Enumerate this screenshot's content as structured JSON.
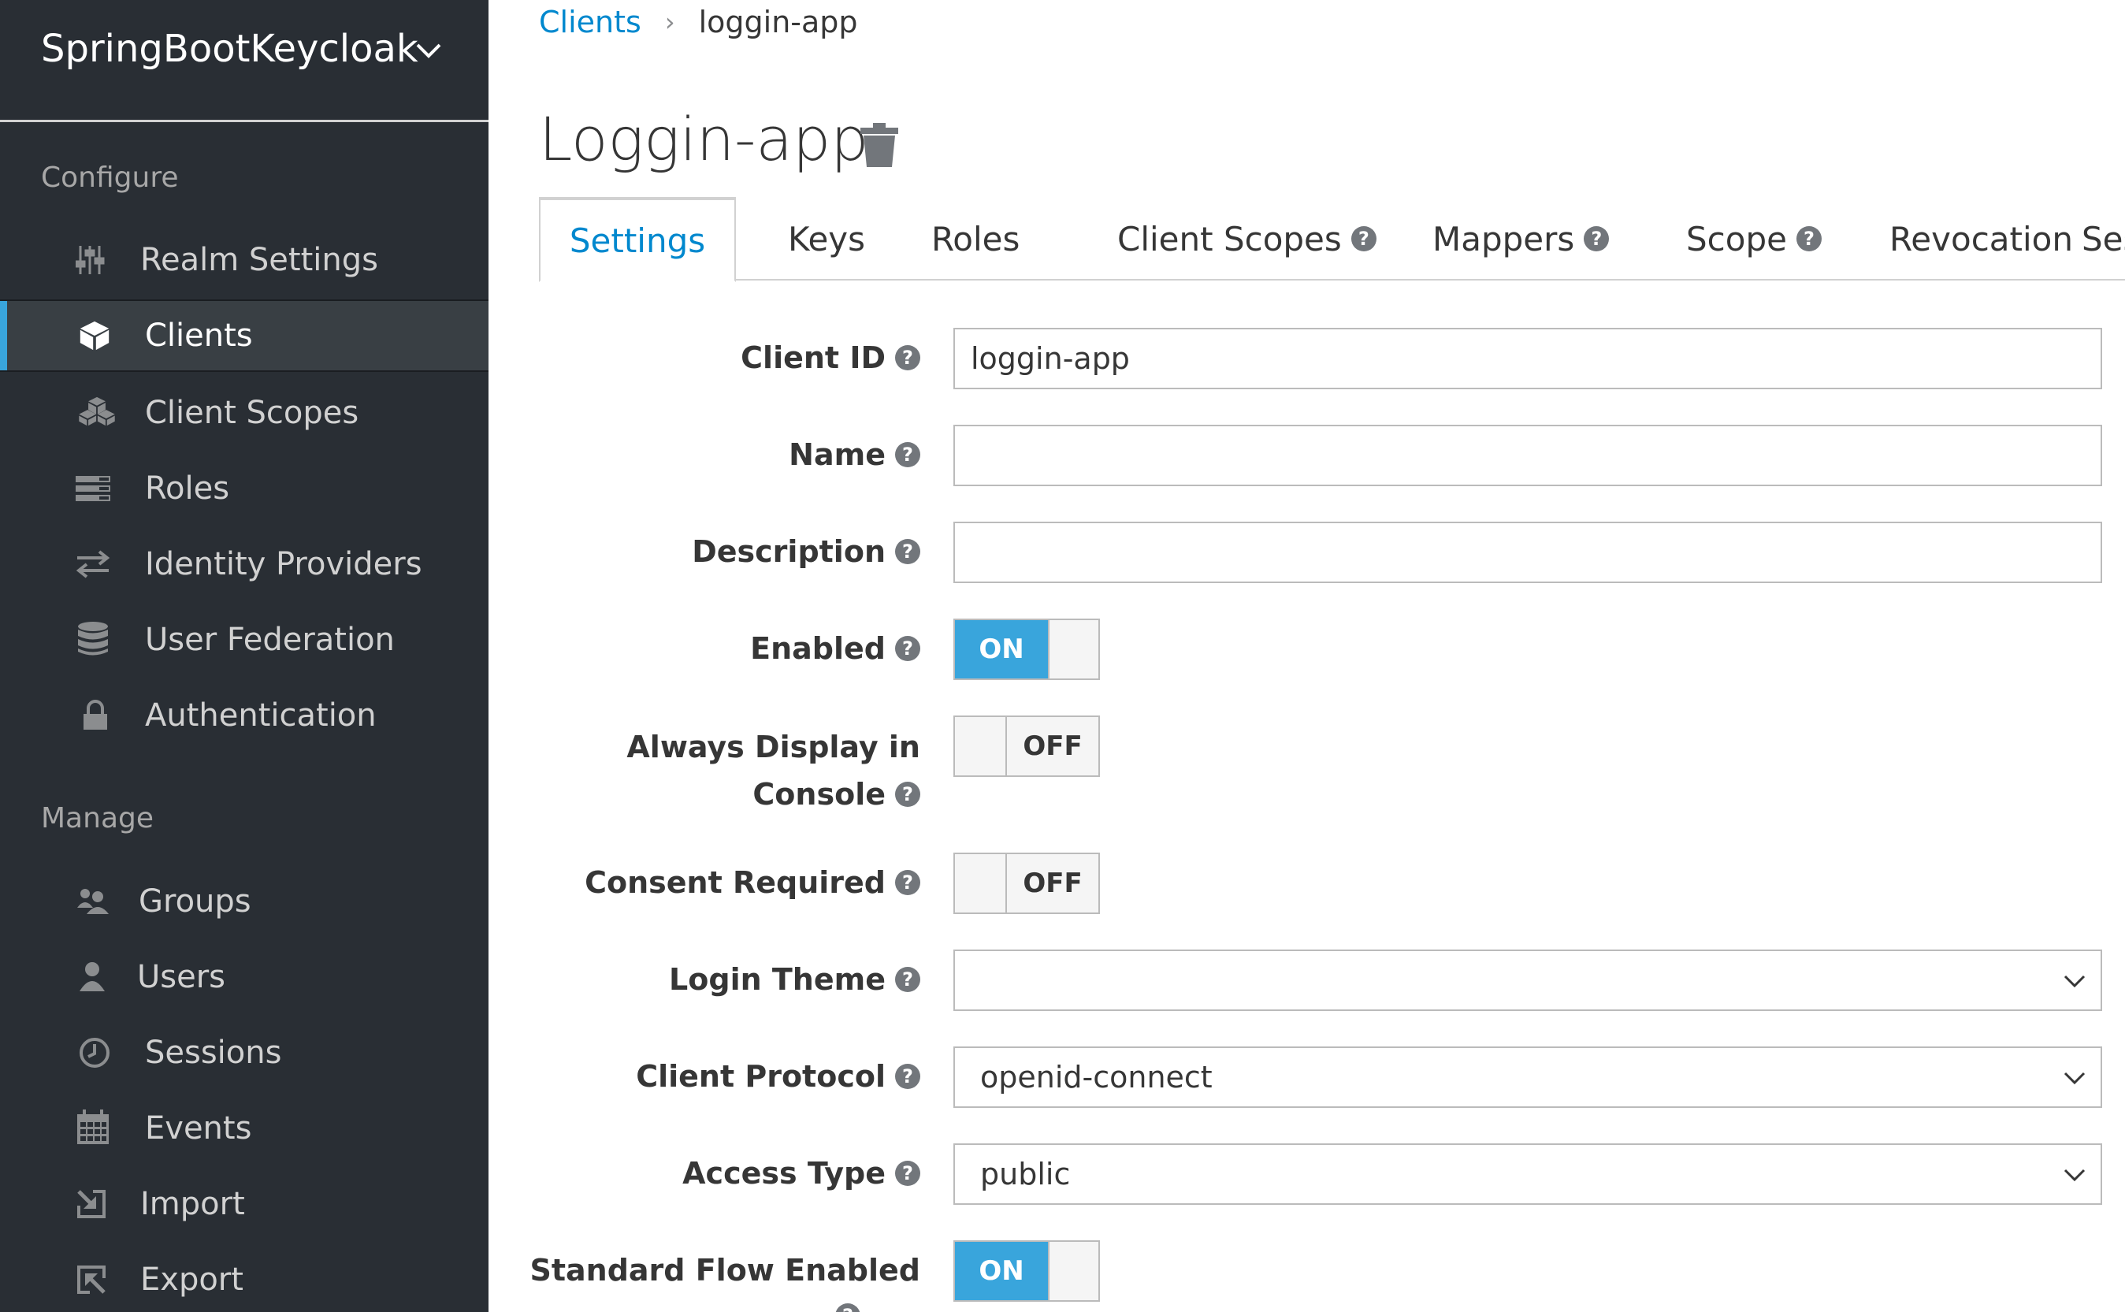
{
  "sidebar": {
    "realm_name": "SpringBootKeycloak",
    "configure_label": "Configure",
    "manage_label": "Manage",
    "configure_items": [
      {
        "label": "Realm Settings",
        "icon": "sliders-icon"
      },
      {
        "label": "Clients",
        "icon": "cube-icon",
        "active": true
      },
      {
        "label": "Client Scopes",
        "icon": "cubes-icon"
      },
      {
        "label": "Roles",
        "icon": "list-icon"
      },
      {
        "label": "Identity Providers",
        "icon": "exchange-icon"
      },
      {
        "label": "User Federation",
        "icon": "database-icon"
      },
      {
        "label": "Authentication",
        "icon": "lock-icon"
      }
    ],
    "manage_items": [
      {
        "label": "Groups",
        "icon": "users-icon"
      },
      {
        "label": "Users",
        "icon": "user-icon"
      },
      {
        "label": "Sessions",
        "icon": "clock-icon"
      },
      {
        "label": "Events",
        "icon": "calendar-icon"
      },
      {
        "label": "Import",
        "icon": "import-icon"
      },
      {
        "label": "Export",
        "icon": "export-icon"
      }
    ]
  },
  "breadcrumb": {
    "parent": "Clients",
    "separator": "›",
    "current": "loggin-app"
  },
  "page": {
    "title": "Loggin-app"
  },
  "tabs": [
    {
      "label": "Settings",
      "active": true,
      "help": false
    },
    {
      "label": "Keys",
      "help": false
    },
    {
      "label": "Roles",
      "help": false
    },
    {
      "label": "Client Scopes",
      "help": true
    },
    {
      "label": "Mappers",
      "help": true
    },
    {
      "label": "Scope",
      "help": true
    },
    {
      "label": "Revocation",
      "help": false
    },
    {
      "label": "Ses",
      "help": false
    }
  ],
  "form": {
    "client_id": {
      "label": "Client ID",
      "value": "loggin-app"
    },
    "name": {
      "label": "Name",
      "value": ""
    },
    "description": {
      "label": "Description",
      "value": ""
    },
    "enabled": {
      "label": "Enabled",
      "state": "ON"
    },
    "always_display": {
      "label_line1": "Always Display in",
      "label_line2": "Console",
      "state": "OFF"
    },
    "consent_required": {
      "label": "Consent Required",
      "state": "OFF"
    },
    "login_theme": {
      "label": "Login Theme",
      "value": ""
    },
    "client_protocol": {
      "label": "Client Protocol",
      "value": "openid-connect"
    },
    "access_type": {
      "label": "Access Type",
      "value": "public"
    },
    "standard_flow": {
      "label": "Standard Flow Enabled",
      "state": "ON"
    }
  },
  "help_glyph": "?",
  "colors": {
    "sidebar_bg": "#292e34",
    "accent": "#39a5dc",
    "link": "#0088ce"
  }
}
